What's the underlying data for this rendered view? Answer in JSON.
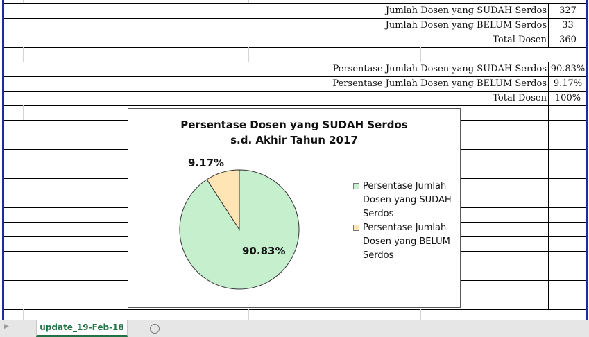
{
  "summary": {
    "rows": [
      {
        "label": "Jumlah Dosen yang SUDAH Serdos",
        "value": "327"
      },
      {
        "label": "Jumlah Dosen yang BELUM Serdos",
        "value": "33"
      },
      {
        "label": "Total Dosen",
        "value": "360"
      }
    ]
  },
  "percent": {
    "rows": [
      {
        "label": "Persentase Jumlah Dosen yang SUDAH Serdos",
        "value": "90.83%"
      },
      {
        "label": "Persentase Jumlah Dosen yang BELUM Serdos",
        "value": "9.17%"
      },
      {
        "label": "Total Dosen",
        "value": "100%"
      }
    ]
  },
  "chart_data": {
    "type": "pie",
    "title": "Persentase Dosen yang SUDAH Serdos",
    "subtitle": "s.d. Akhir Tahun 2017",
    "categories": [
      "Persentase Jumlah Dosen yang SUDAH Serdos",
      "Persentase Jumlah Dosen yang BELUM Serdos"
    ],
    "values": [
      90.83,
      9.17
    ],
    "data_labels": [
      "90.83%",
      "9.17%"
    ],
    "legend_lines": [
      [
        "Persentase Jumlah",
        "Dosen yang SUDAH",
        "Serdos"
      ],
      [
        "Persentase Jumlah",
        "Dosen yang BELUM",
        "Serdos"
      ]
    ],
    "colors": [
      "#c6efce",
      "#ffe5b4"
    ],
    "legend_position": "right"
  },
  "tabs": {
    "active_label": "update_19-Feb-18",
    "nav_arrow": "▶"
  },
  "colors": {
    "accent": "#217346",
    "frame_blue": "#1f2a9c"
  }
}
